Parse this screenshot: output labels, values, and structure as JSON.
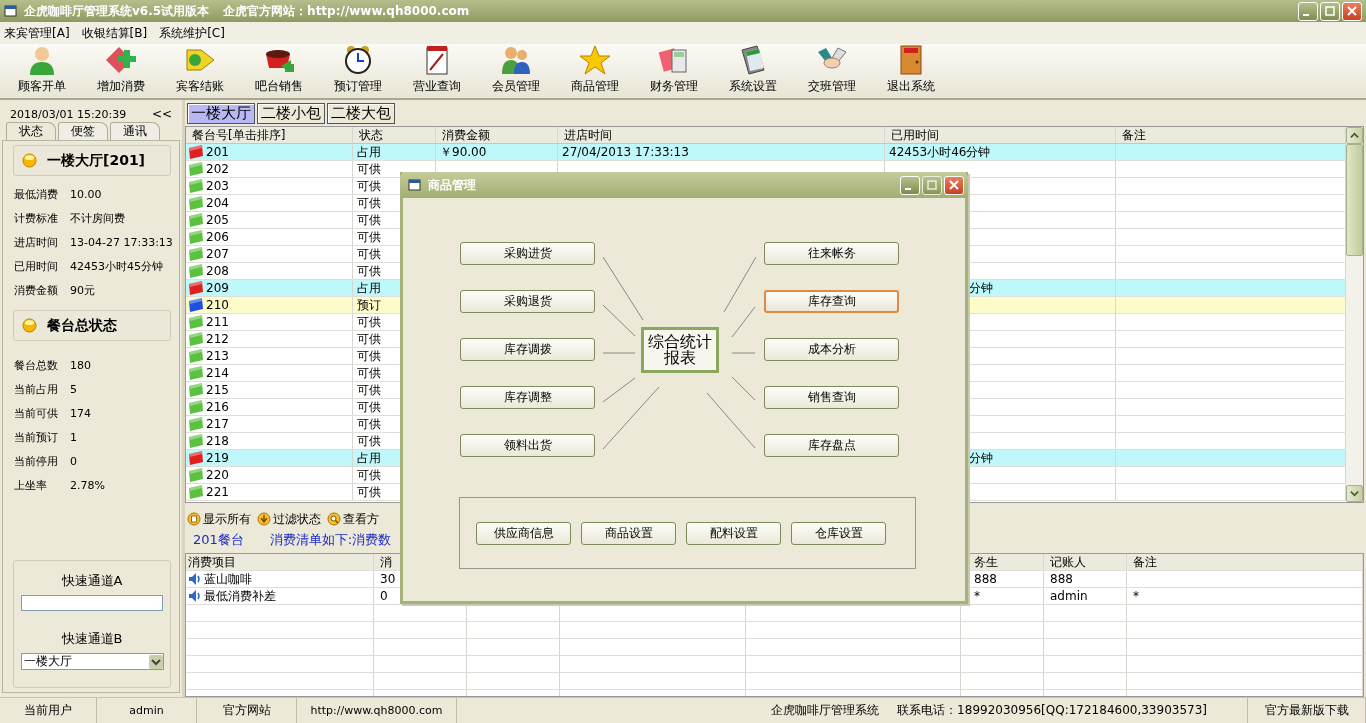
{
  "window": {
    "title": "企虎咖啡厅管理系统v6.5试用版本",
    "site": "企虎官方网站：http://www.qh8000.com"
  },
  "menu": [
    "来宾管理[A]",
    "收银结算[B]",
    "系统维护[C]"
  ],
  "toolbar": [
    "顾客开单",
    "增加消费",
    "宾客结账",
    "吧台销售",
    "预订管理",
    "营业查询",
    "会员管理",
    "商品管理",
    "财务管理",
    "系统设置",
    "交班管理",
    "退出系统"
  ],
  "left_panel": {
    "datetime": "2018/03/01 15:20:39",
    "collapse": "<<",
    "tabs": [
      {
        "label": "状态",
        "selected": true
      },
      {
        "label": "便签",
        "selected": false
      },
      {
        "label": "通讯",
        "selected": false
      }
    ],
    "table_section": {
      "title": "一楼大厅[201]",
      "fields": [
        {
          "label": "最低消费",
          "value": "10.00"
        },
        {
          "label": "计费标准",
          "value": "不计房间费"
        },
        {
          "label": "进店时间",
          "value": "13-04-27 17:33:13"
        },
        {
          "label": "已用时间",
          "value": "42453小时45分钟"
        },
        {
          "label": "消费金额",
          "value": "90元"
        }
      ]
    },
    "summary_section": {
      "title": "餐台总状态",
      "fields": [
        {
          "label": "餐台总数",
          "value": "180"
        },
        {
          "label": "当前占用",
          "value": "5"
        },
        {
          "label": "当前可供",
          "value": "174"
        },
        {
          "label": "当前预订",
          "value": "1"
        },
        {
          "label": "当前停用",
          "value": "0"
        },
        {
          "label": "上坐率",
          "value": "2.78%"
        }
      ]
    },
    "quick_a": {
      "label": "快速通道A"
    },
    "quick_b": {
      "label": "快速通道B",
      "value": "一楼大厅"
    }
  },
  "area_tabs": [
    {
      "label": "一楼大厅",
      "selected": true
    },
    {
      "label": "二楼小包",
      "selected": false
    },
    {
      "label": "二楼大包",
      "selected": false
    }
  ],
  "tables": {
    "columns": [
      "餐台号[单击排序]",
      "状态",
      "消费金额",
      "进店时间",
      "已用时间",
      "备注"
    ],
    "rows": [
      {
        "number": "201",
        "status": "占用",
        "kind": "occupied",
        "amount": "￥90.00",
        "entered": "27/04/2013 17:33:13",
        "used": "42453小时46分钟"
      },
      {
        "number": "202",
        "status": "可供",
        "kind": "available"
      },
      {
        "number": "203",
        "status": "可供",
        "kind": "available"
      },
      {
        "number": "204",
        "status": "可供",
        "kind": "available"
      },
      {
        "number": "205",
        "status": "可供",
        "kind": "available"
      },
      {
        "number": "206",
        "status": "可供",
        "kind": "available"
      },
      {
        "number": "207",
        "status": "可供",
        "kind": "available"
      },
      {
        "number": "208",
        "status": "可供",
        "kind": "available"
      },
      {
        "number": "209",
        "status": "占用",
        "kind": "occupied",
        "used": "分钟"
      },
      {
        "number": "210",
        "status": "预订",
        "kind": "reserved"
      },
      {
        "number": "211",
        "status": "可供",
        "kind": "available"
      },
      {
        "number": "212",
        "status": "可供",
        "kind": "available"
      },
      {
        "number": "213",
        "status": "可供",
        "kind": "available"
      },
      {
        "number": "214",
        "status": "可供",
        "kind": "available"
      },
      {
        "number": "215",
        "status": "可供",
        "kind": "available"
      },
      {
        "number": "216",
        "status": "可供",
        "kind": "available"
      },
      {
        "number": "217",
        "status": "可供",
        "kind": "available"
      },
      {
        "number": "218",
        "status": "可供",
        "kind": "available"
      },
      {
        "number": "219",
        "status": "占用",
        "kind": "occupied",
        "used": "分钟"
      },
      {
        "number": "220",
        "status": "可供",
        "kind": "available"
      },
      {
        "number": "221",
        "status": "可供",
        "kind": "available"
      }
    ]
  },
  "actions": [
    "显示所有",
    "过滤状态",
    "查看方"
  ],
  "order": {
    "table": "201餐台",
    "caption": "消费清单如下:消费数"
  },
  "items": {
    "columns": [
      "消费项目",
      "消",
      "",
      "",
      "",
      "务生",
      "记账人",
      "备注"
    ],
    "rows": [
      {
        "item": "蓝山咖啡",
        "qty": "30",
        "waiter": "888",
        "clerk": "888",
        "note": ""
      },
      {
        "item": "最低消费补差",
        "qty": "0",
        "waiter": "*",
        "clerk": "admin",
        "note": "*"
      }
    ]
  },
  "status_bar": {
    "user_label": "当前用户",
    "user": "admin",
    "site_label": "官方网站",
    "site": "http://www.qh8000.com",
    "product": "企虎咖啡厅管理系统",
    "phone": "联系电话：18992030956[QQ:172184600,33903573]",
    "download": "官方最新版下载"
  },
  "dialog": {
    "title": "商品管理",
    "center": "综合统计报表",
    "left_buttons": [
      {
        "label": "采购进货",
        "focused": false
      },
      {
        "label": "采购退货",
        "focused": false
      },
      {
        "label": "库存调拨",
        "focused": false
      },
      {
        "label": "库存调整",
        "focused": false
      },
      {
        "label": "领料出货",
        "focused": false
      }
    ],
    "right_buttons": [
      {
        "label": "往来帐务",
        "focused": false
      },
      {
        "label": "库存查询",
        "focused": true
      },
      {
        "label": "成本分析",
        "focused": false
      },
      {
        "label": "销售查询",
        "focused": false
      },
      {
        "label": "库存盘点",
        "focused": false
      }
    ],
    "bottom_buttons": [
      "供应商信息",
      "商品设置",
      "配料设置",
      "仓库设置"
    ]
  }
}
